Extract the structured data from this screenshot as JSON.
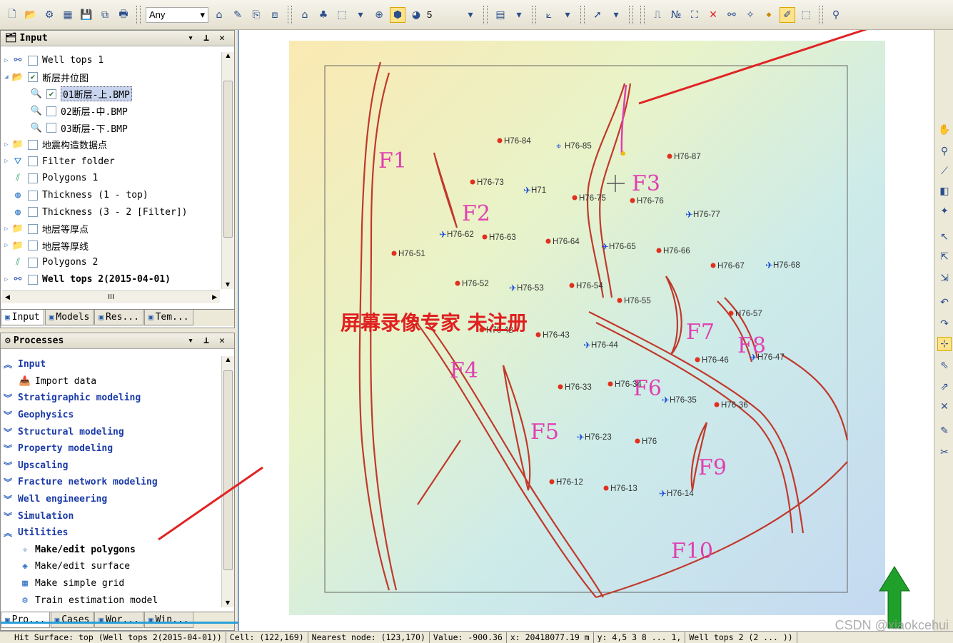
{
  "toolbar": {
    "filter_value": "Any",
    "count_value": "5"
  },
  "input_panel": {
    "title": "Input",
    "items": [
      {
        "label": "Well tops 1",
        "icon": "well-tops-icon",
        "checked": false,
        "level": 0,
        "expander": "▷"
      },
      {
        "label": "断层井位图",
        "icon": "folder-open-icon",
        "checked": true,
        "level": 0,
        "expander": "◢"
      },
      {
        "label": "01断层-上.BMP",
        "icon": "bitmap-icon",
        "checked": true,
        "level": 1,
        "selected": true
      },
      {
        "label": "02断层-中.BMP",
        "icon": "bitmap-icon",
        "checked": false,
        "level": 1
      },
      {
        "label": "03断层-下.BMP",
        "icon": "bitmap-icon",
        "checked": false,
        "level": 1
      },
      {
        "label": "地震构造数据点",
        "icon": "folder-icon",
        "checked": false,
        "level": 0,
        "expander": "▷"
      },
      {
        "label": "Filter folder",
        "icon": "filter-folder-icon",
        "checked": false,
        "level": 0,
        "expander": "▷"
      },
      {
        "label": "Polygons 1",
        "icon": "polygons-icon",
        "checked": false,
        "level": 0
      },
      {
        "label": "Thickness (1 - top)",
        "icon": "surface-icon",
        "checked": false,
        "level": 0
      },
      {
        "label": "Thickness (3 - 2 [Filter])",
        "icon": "surface-icon",
        "checked": false,
        "level": 0
      },
      {
        "label": "地层等厚点",
        "icon": "folder-icon",
        "checked": false,
        "level": 0,
        "expander": "▷"
      },
      {
        "label": "地层等厚线",
        "icon": "folder-icon",
        "checked": false,
        "level": 0,
        "expander": "▷"
      },
      {
        "label": "Polygons 2",
        "icon": "polygons-icon",
        "checked": false,
        "level": 0
      },
      {
        "label": "Well tops 2(2015-04-01)",
        "icon": "well-tops-icon",
        "checked": false,
        "level": 0,
        "expander": "▷",
        "bold": true
      }
    ],
    "hscroll_label": "III",
    "tabs": [
      "Input",
      "Models",
      "Res...",
      "Tem..."
    ]
  },
  "processes_panel": {
    "title": "Processes",
    "items": [
      {
        "label": "Input",
        "type": "group",
        "chevron": "up"
      },
      {
        "label": "Import data",
        "type": "item",
        "icon": "import-icon"
      },
      {
        "label": "Stratigraphic modeling",
        "type": "group",
        "chevron": "down"
      },
      {
        "label": "Geophysics",
        "type": "group",
        "chevron": "down"
      },
      {
        "label": "Structural modeling",
        "type": "group",
        "chevron": "down"
      },
      {
        "label": "Property modeling",
        "type": "group",
        "chevron": "down"
      },
      {
        "label": "Upscaling",
        "type": "group",
        "chevron": "down"
      },
      {
        "label": "Fracture network modeling",
        "type": "group",
        "chevron": "down"
      },
      {
        "label": "Well engineering",
        "type": "group",
        "chevron": "down"
      },
      {
        "label": "Simulation",
        "type": "group",
        "chevron": "down"
      },
      {
        "label": "Utilities",
        "type": "group",
        "chevron": "up"
      },
      {
        "label": "Make/edit polygons",
        "type": "item",
        "icon": "polygon-edit-icon",
        "bold": true
      },
      {
        "label": "Make/edit surface",
        "type": "item",
        "icon": "surface-edit-icon"
      },
      {
        "label": "Make simple grid",
        "type": "item",
        "icon": "grid-icon"
      },
      {
        "label": "Train estimation model",
        "type": "item",
        "icon": "train-icon"
      }
    ],
    "tabs": [
      "Pro...",
      "Cases",
      "Wor...",
      "Win..."
    ]
  },
  "map": {
    "faults": [
      {
        "label": "F1"
      },
      {
        "label": "F2"
      },
      {
        "label": "F3"
      },
      {
        "label": "F4"
      },
      {
        "label": "F5"
      },
      {
        "label": "F6"
      },
      {
        "label": "F7"
      },
      {
        "label": "F8"
      },
      {
        "label": "F9"
      },
      {
        "label": "F10"
      }
    ],
    "wells": [
      {
        "name": "H76-84",
        "kind": "red"
      },
      {
        "name": "H76-85",
        "kind": "target"
      },
      {
        "name": "H76-87",
        "kind": "red"
      },
      {
        "name": "H76-73",
        "kind": "red"
      },
      {
        "name": "H71",
        "kind": "blue"
      },
      {
        "name": "H76-75",
        "kind": "red"
      },
      {
        "name": "H76-76",
        "kind": "red"
      },
      {
        "name": "H76-77",
        "kind": "blue"
      },
      {
        "name": "H76-62",
        "kind": "blue"
      },
      {
        "name": "H76-63",
        "kind": "red"
      },
      {
        "name": "H76-64",
        "kind": "red"
      },
      {
        "name": "H76-65",
        "kind": "blue"
      },
      {
        "name": "H76-66",
        "kind": "red"
      },
      {
        "name": "H76-51",
        "kind": "red"
      },
      {
        "name": "H76-67",
        "kind": "red"
      },
      {
        "name": "H76-68",
        "kind": "blue"
      },
      {
        "name": "H76-52",
        "kind": "red"
      },
      {
        "name": "H76-53",
        "kind": "blue"
      },
      {
        "name": "H76-54",
        "kind": "red"
      },
      {
        "name": "H76-55",
        "kind": "red"
      },
      {
        "name": "H76-57",
        "kind": "red"
      },
      {
        "name": "H76-42",
        "kind": "red"
      },
      {
        "name": "H76-43",
        "kind": "red"
      },
      {
        "name": "H76-44",
        "kind": "blue"
      },
      {
        "name": "H76-46",
        "kind": "red"
      },
      {
        "name": "H76-47",
        "kind": "blue"
      },
      {
        "name": "H76-33",
        "kind": "red"
      },
      {
        "name": "H76-34",
        "kind": "red"
      },
      {
        "name": "H76-35",
        "kind": "blue"
      },
      {
        "name": "H76-36",
        "kind": "red"
      },
      {
        "name": "H76-23",
        "kind": "blue"
      },
      {
        "name": "H76",
        "kind": "red"
      },
      {
        "name": "H76-12",
        "kind": "red"
      },
      {
        "name": "H76-13",
        "kind": "red"
      },
      {
        "name": "H76-14",
        "kind": "blue"
      }
    ],
    "overlay_text": "屏幕录像专家  未注册"
  },
  "status_bar": {
    "hit": "Hit Surface: top (Well tops 2(2015-04-01))",
    "cell": "Cell: (122,169)",
    "node": "Nearest node: (123,170)",
    "value": "Value: -900.36",
    "x": "x: 20418077.19 m",
    "y": "y: 4,5 3 8 ... 1,  ",
    "tail": "Well tops 2 (2 ... ))"
  },
  "watermark": "CSDN @xiaokcehui",
  "colors": {
    "fault_line": "#c0392b",
    "fault_label": "#e040b0",
    "well_red": "#e0301e",
    "well_blue": "#1e4fd8",
    "overlay_text": "#e02020"
  }
}
